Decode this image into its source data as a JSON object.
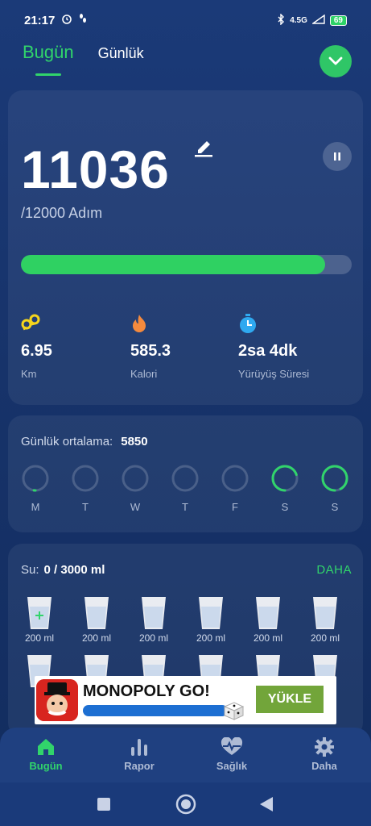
{
  "status_bar": {
    "time": "21:17",
    "network": "4.5G",
    "battery": "69"
  },
  "tabs": [
    {
      "label": "Bugün",
      "active": true
    },
    {
      "label": "Günlük",
      "active": false
    }
  ],
  "steps": {
    "count": "11036",
    "goal_text": "/12000 Adım",
    "progress_fraction": 0.92
  },
  "stats": [
    {
      "icon": "location-pin-icon",
      "value": "6.95",
      "label": "Km",
      "color": "#f5d51c"
    },
    {
      "icon": "flame-icon",
      "value": "585.3",
      "label": "Kalori",
      "color": "#f58a3d"
    },
    {
      "icon": "timer-icon",
      "value": "2sa 4dk",
      "label": "Yürüyüş Süresi",
      "color": "#2fa9f0"
    }
  ],
  "daily_average": {
    "label": "Günlük ortalama:",
    "value": "5850",
    "days": [
      {
        "label": "M",
        "fraction": 0.02
      },
      {
        "label": "T",
        "fraction": 0
      },
      {
        "label": "W",
        "fraction": 0
      },
      {
        "label": "T",
        "fraction": 0
      },
      {
        "label": "F",
        "fraction": 0
      },
      {
        "label": "S",
        "fraction": 0.7
      },
      {
        "label": "S",
        "fraction": 0.92
      }
    ]
  },
  "water": {
    "label": "Su:",
    "amount": "0 / 3000 ml",
    "more_label": "DAHA",
    "cups": [
      "200 ml",
      "200 ml",
      "200 ml",
      "200 ml",
      "200 ml",
      "200 ml"
    ]
  },
  "ad": {
    "title": "MONOPOLY GO!",
    "button": "YÜKLE"
  },
  "bottom_nav": [
    {
      "label": "Bugün",
      "icon": "home-icon",
      "active": true
    },
    {
      "label": "Rapor",
      "icon": "bar-chart-icon",
      "active": false
    },
    {
      "label": "Sağlık",
      "icon": "heart-pulse-icon",
      "active": false
    },
    {
      "label": "Daha",
      "icon": "gear-icon",
      "active": false
    }
  ],
  "colors": {
    "accent": "#31d46b",
    "background": "#17336a"
  }
}
